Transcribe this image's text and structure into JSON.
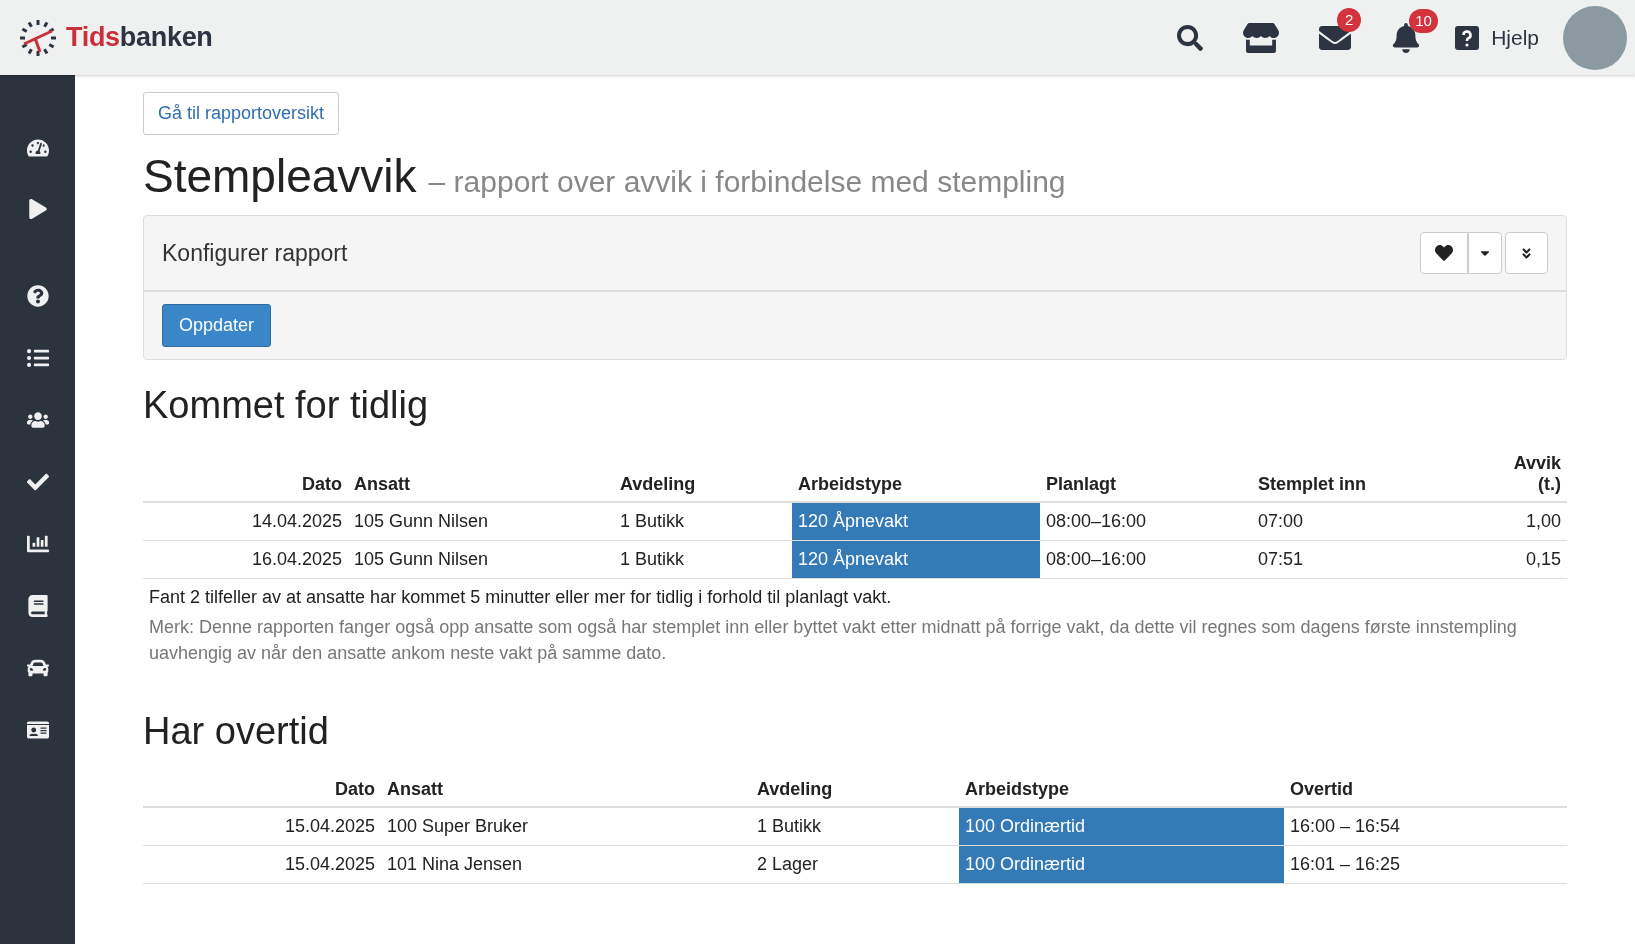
{
  "topbar": {
    "logo_first": "Tids",
    "logo_second": "banken",
    "mail_badge": "2",
    "bell_badge": "10",
    "help": "Hjelp"
  },
  "back_button": "Gå til rapportoversikt",
  "title": "Stempleavvik",
  "subtitle": "– rapport over avvik i forbindelse med stempling",
  "config": {
    "title": "Konfigurer rapport",
    "update_button": "Oppdater"
  },
  "sections": [
    {
      "heading": "Kommet for tidlig",
      "columns": [
        "Dato",
        "Ansatt",
        "Avdeling",
        "Arbeidstype",
        "Planlagt",
        "Stemplet inn",
        "Avvik (t.)"
      ],
      "rows": [
        {
          "cells": [
            "14.04.2025",
            "105 Gunn Nilsen",
            "1 Butikk",
            "120 Åpnevakt",
            "08:00–16:00",
            "07:00",
            "1,00"
          ]
        },
        {
          "cells": [
            "16.04.2025",
            "105 Gunn Nilsen",
            "1 Butikk",
            "120 Åpnevakt",
            "08:00–16:00",
            "07:51",
            "0,15"
          ]
        }
      ],
      "summary": "Fant 2 tilfeller av at ansatte har kommet 5 minutter eller mer for tidlig i forhold til planlagt vakt.",
      "note": "Merk: Denne rapporten fanger også opp ansatte som også har stemplet inn eller byttet vakt etter midnatt på forrige vakt, da dette vil regnes som dagens første innstempling uavhengig av når den ansatte ankom neste vakt på samme dato."
    },
    {
      "heading": "Har overtid",
      "columns": [
        "Dato",
        "Ansatt",
        "Avdeling",
        "Arbeidstype",
        "Overtid"
      ],
      "rows": [
        {
          "cells": [
            "15.04.2025",
            "100 Super Bruker",
            "1 Butikk",
            "100 Ordinærtid",
            "16:00 – 16:54"
          ]
        },
        {
          "cells": [
            "15.04.2025",
            "101 Nina Jensen",
            "2 Lager",
            "100 Ordinærtid",
            "16:01 – 16:25"
          ]
        }
      ]
    }
  ]
}
